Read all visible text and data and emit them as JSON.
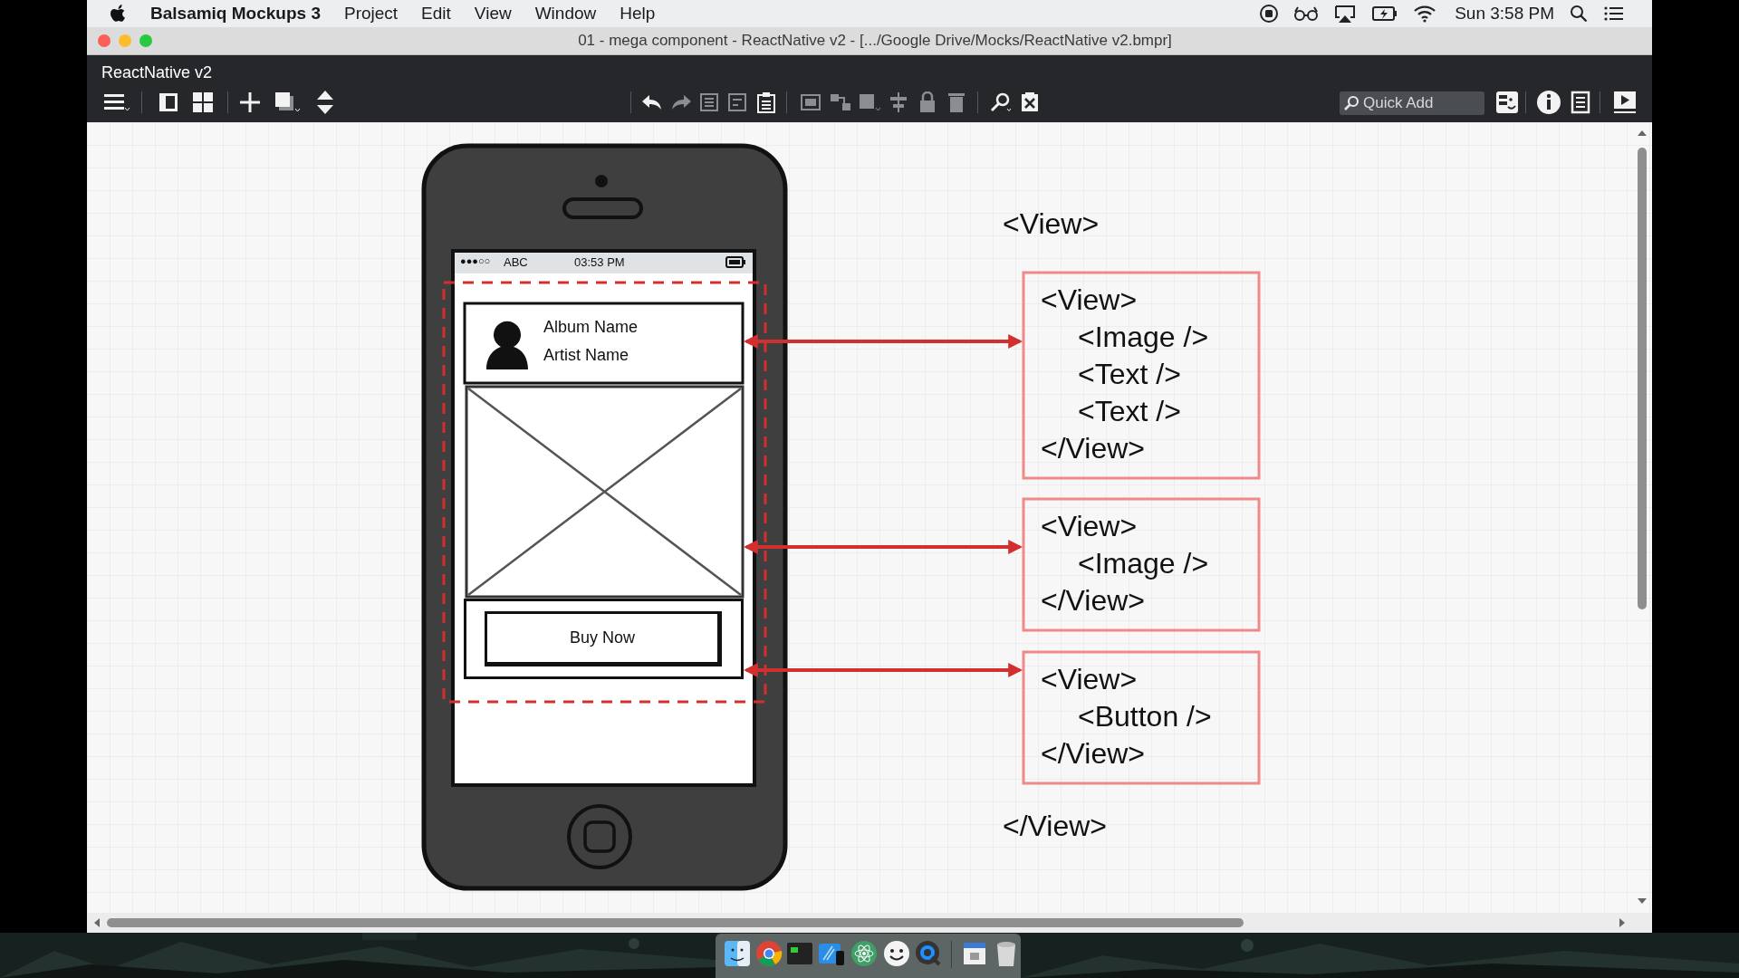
{
  "menu_bar": {
    "app": "Balsamiq Mockups 3",
    "menus": [
      "Project",
      "Edit",
      "View",
      "Window",
      "Help"
    ],
    "clock": "Sun 3:58 PM"
  },
  "window": {
    "title": "01 - mega component - ReactNative v2 - [.../Google Drive/Mocks/ReactNative v2.bmpr]"
  },
  "project": {
    "name": "ReactNative v2"
  },
  "toolbar": {
    "quick_add": {
      "placeholder": "Quick Add"
    }
  },
  "mockup": {
    "phone": {
      "signal": "●●●○○",
      "carrier": "ABC",
      "time": "03:53 PM",
      "album": "Album Name",
      "artist": "Artist Name",
      "button": "Buy Now"
    },
    "outer_open": "<View>",
    "boxes": [
      {
        "open": "<View>",
        "children": [
          "<Image />",
          "<Text />",
          "<Text />"
        ],
        "close": "</View>"
      },
      {
        "open": "<View>",
        "children": [
          "<Image />"
        ],
        "close": "</View>"
      },
      {
        "open": "<View>",
        "children": [
          "<Button />"
        ],
        "close": "</View>"
      }
    ],
    "outer_close": "</View>"
  }
}
